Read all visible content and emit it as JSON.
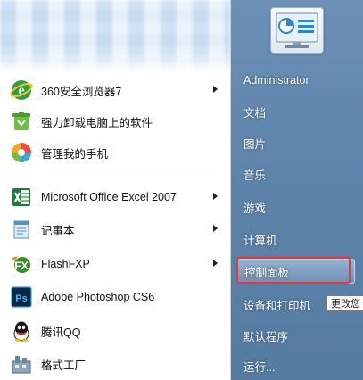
{
  "left_menu": {
    "items": [
      {
        "label": "360安全浏览器7",
        "has_submenu": true,
        "icon": "ie-360-icon"
      },
      {
        "label": "强力卸载电脑上的软件",
        "has_submenu": false,
        "icon": "uninstall-icon"
      },
      {
        "label": "管理我的手机",
        "has_submenu": false,
        "icon": "phone-manager-icon"
      },
      {
        "label": "Microsoft Office Excel 2007",
        "has_submenu": true,
        "icon": "excel-icon"
      },
      {
        "label": "记事本",
        "has_submenu": true,
        "icon": "notepad-icon"
      },
      {
        "label": "FlashFXP",
        "has_submenu": true,
        "icon": "flashfxp-icon"
      },
      {
        "label": "Adobe Photoshop CS6",
        "has_submenu": false,
        "icon": "photoshop-icon"
      },
      {
        "label": "腾讯QQ",
        "has_submenu": false,
        "icon": "qq-icon"
      },
      {
        "label": "格式工厂",
        "has_submenu": false,
        "icon": "format-factory-icon"
      }
    ]
  },
  "right_menu": {
    "items": [
      {
        "label": "Administrator"
      },
      {
        "label": "文档"
      },
      {
        "label": "图片"
      },
      {
        "label": "音乐"
      },
      {
        "label": "游戏"
      },
      {
        "label": "计算机"
      },
      {
        "label": "控制面板"
      },
      {
        "label": "设备和打印机"
      },
      {
        "label": "默认程序"
      },
      {
        "label": "运行..."
      }
    ]
  },
  "tooltip": {
    "text": "更改您"
  },
  "colors": {
    "accent_blue": "#5f84ab",
    "highlight_red": "#e03a3a"
  }
}
